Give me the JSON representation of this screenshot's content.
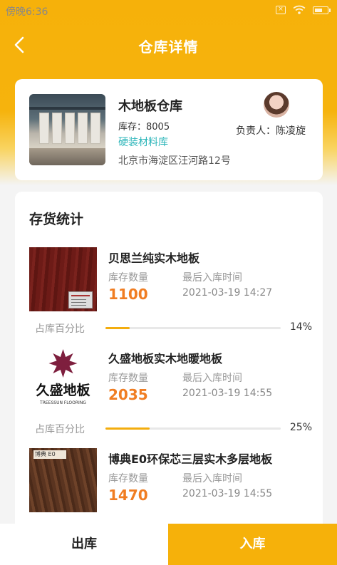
{
  "status_bar": {
    "time": "傍晚6:36"
  },
  "header": {
    "title": "仓库详情"
  },
  "warehouse": {
    "name": "木地板仓库",
    "stock": "库存：8005",
    "type": "硬装材料库",
    "address": "北京市海淀区汪河路12号",
    "manager": "负责人：陈凌旋"
  },
  "stats": {
    "title": "存货统计",
    "qty_label": "库存数量",
    "time_label": "最后入库时间",
    "pct_label": "占库百分比",
    "items": [
      {
        "name": "贝思兰纯实木地板",
        "qty": "1100",
        "time": "2021-03-19 14:27",
        "pct": "14%",
        "pct_value": 14
      },
      {
        "name": "久盛地板实木地暖地板",
        "qty": "2035",
        "time": "2021-03-19 14:55",
        "pct": "25%",
        "pct_value": 25,
        "logo_text": "久盛地板",
        "logo_sub": "TREESSUN FLOORING"
      },
      {
        "name": "博典E0环保芯三层实木多层地板",
        "qty": "1470",
        "time": "2021-03-19 14:55"
      }
    ]
  },
  "bottom": {
    "out_label": "出库",
    "in_label": "入库"
  },
  "colors": {
    "accent": "#f6b10a",
    "qty": "#f07d22",
    "type": "#2bb5b9"
  }
}
